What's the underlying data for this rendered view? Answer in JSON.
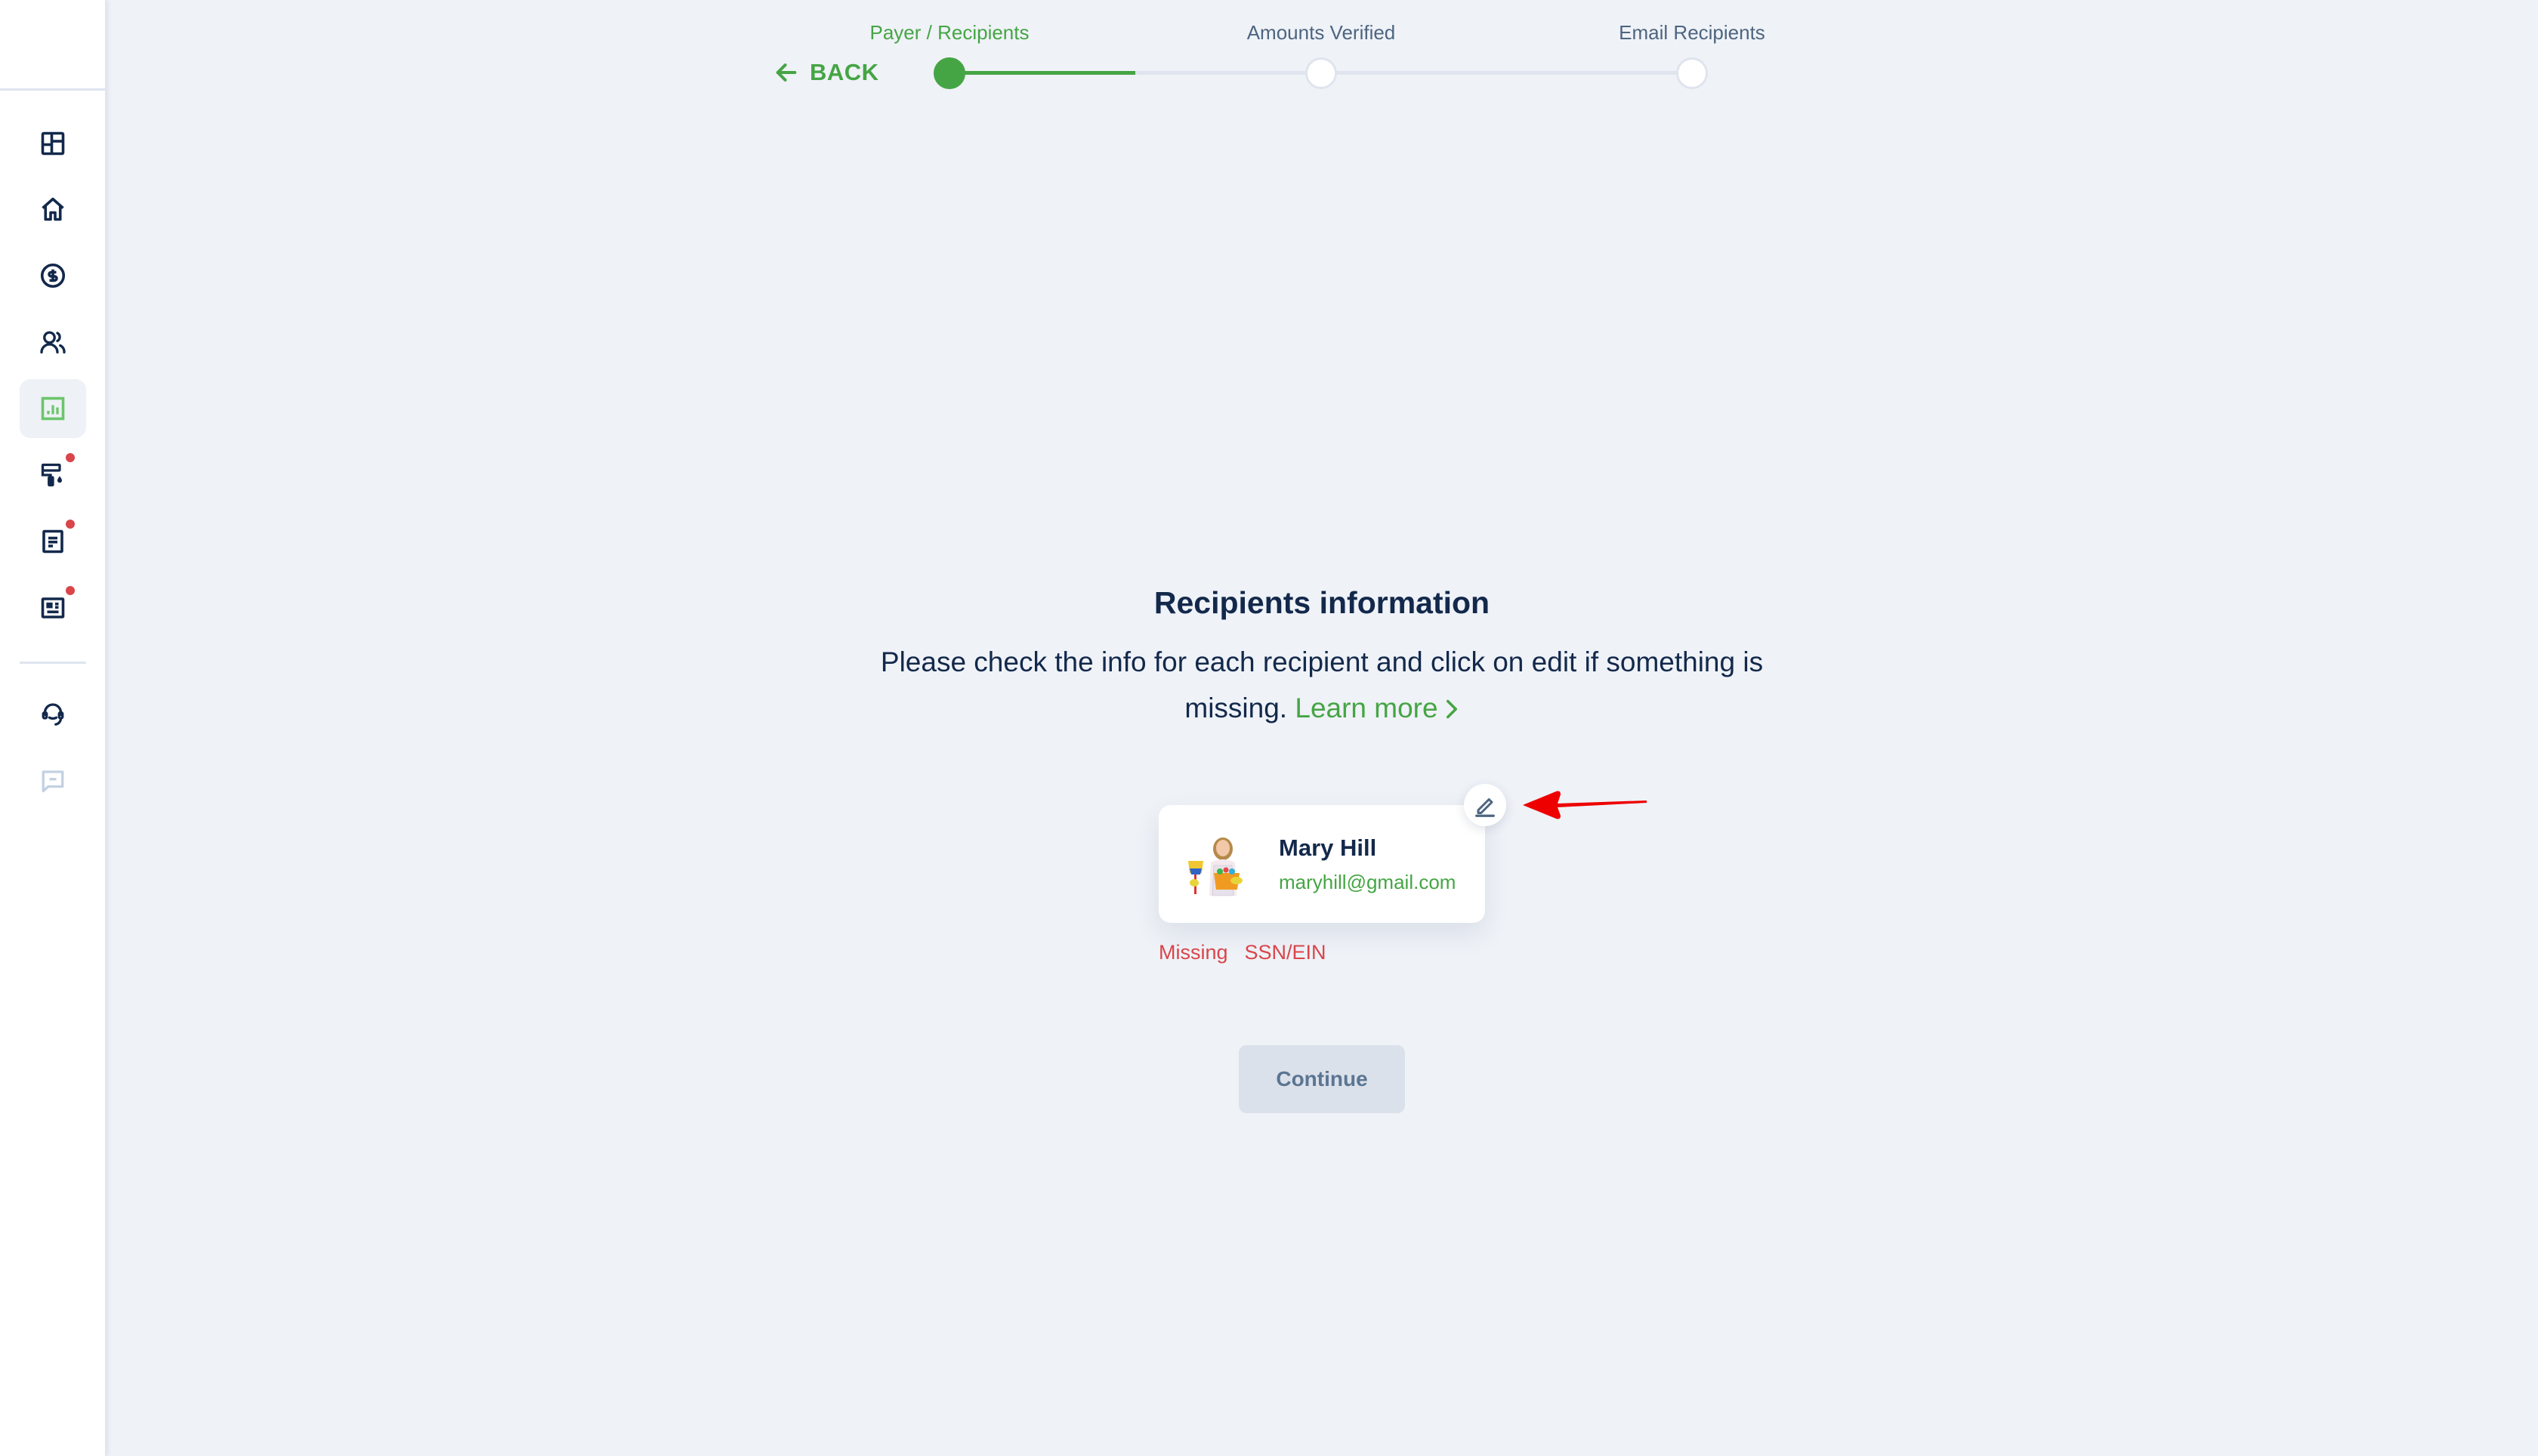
{
  "sidebar": {
    "items": [
      {
        "name": "dashboard",
        "icon": "layout-grid-icon",
        "active": false,
        "notification": false
      },
      {
        "name": "home",
        "icon": "home-icon",
        "active": false,
        "notification": false
      },
      {
        "name": "payments",
        "icon": "dollar-circle-icon",
        "active": false,
        "notification": false
      },
      {
        "name": "contacts",
        "icon": "users-icon",
        "active": false,
        "notification": false
      },
      {
        "name": "reports",
        "icon": "bar-chart-icon",
        "active": true,
        "notification": false
      },
      {
        "name": "services",
        "icon": "paint-roller-icon",
        "active": false,
        "notification": true
      },
      {
        "name": "documents",
        "icon": "document-icon",
        "active": false,
        "notification": true
      },
      {
        "name": "forms",
        "icon": "id-card-icon",
        "active": false,
        "notification": true
      }
    ],
    "bottom_items": [
      {
        "name": "support",
        "icon": "headset-icon"
      },
      {
        "name": "chat",
        "icon": "chat-icon"
      }
    ],
    "colors": {
      "icon": "#13294b",
      "active": "#45a544",
      "dot": "#d9454a",
      "muted": "#c3d0e2"
    }
  },
  "stepper": {
    "back_label": "BACK",
    "steps": [
      {
        "label": "Payer / Recipients",
        "state": "active"
      },
      {
        "label": "Amounts Verified",
        "state": "pending"
      },
      {
        "label": "Email Recipients",
        "state": "pending"
      }
    ],
    "progress_fraction_first_segment": 0.5
  },
  "main": {
    "title": "Recipients information",
    "description": "Please check the info for each recipient and click on edit if something is missing.",
    "learn_more_label": "Learn more",
    "learn_more_chevron": "›",
    "recipient": {
      "name": "Mary Hill",
      "email": "maryhill@gmail.com",
      "avatar": "recipient-photo"
    },
    "missing_label": "Missing",
    "missing_field": "SSN/EIN",
    "continue_label": "Continue",
    "continue_disabled": true
  },
  "colors": {
    "brand_green": "#45a544",
    "text_dark": "#13294b",
    "error_red": "#d9454a",
    "background": "#eff2f7",
    "annotation_arrow": "#ee0000"
  }
}
